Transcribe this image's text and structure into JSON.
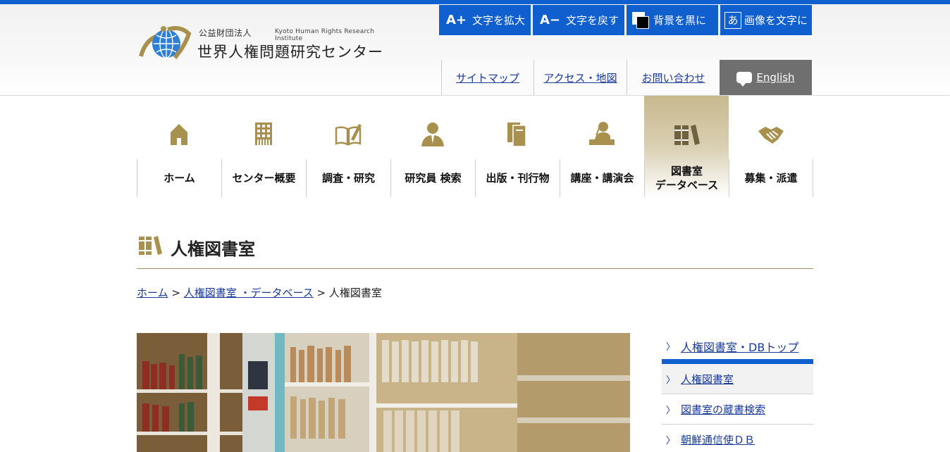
{
  "logo": {
    "org_type": "公益財団法人",
    "name_en": "Kyoto Human Rights Research Institute",
    "name_ja": "世界人権問題研究センター"
  },
  "accessibility": {
    "enlarge_icon": "A+",
    "enlarge": "文字を拡大",
    "reset_icon": "A−",
    "reset": "文字を戻す",
    "bg_black": "背景を黒に",
    "img_text_icon": "あ",
    "img_text": "画像を文字に"
  },
  "utility": {
    "sitemap": "サイトマップ",
    "access": "アクセス・地図",
    "contact": "お問い合わせ",
    "english": "English"
  },
  "nav": [
    {
      "label": "ホーム",
      "icon": "home-icon"
    },
    {
      "label": "センター概要",
      "icon": "building-icon"
    },
    {
      "label": "調査・研究",
      "icon": "book-pen-icon"
    },
    {
      "label": "研究員 検索",
      "icon": "person-icon"
    },
    {
      "label": "出版・刊行物",
      "icon": "publication-icon"
    },
    {
      "label": "講座・講演会",
      "icon": "lecture-icon"
    },
    {
      "label_line1": "図書室",
      "label_line2": "データベース",
      "icon": "books-icon"
    },
    {
      "label": "募集・派遣",
      "icon": "handshake-icon"
    }
  ],
  "page": {
    "title": "人権図書室"
  },
  "breadcrumb": {
    "home": "ホーム",
    "sep": ">",
    "parent": "人権図書室 ・データベース",
    "current": "人権図書室"
  },
  "side_menu": {
    "top": "人権図書室・DBトップ",
    "items": [
      "人権図書室",
      "図書室の蔵書検索",
      "朝鮮通信使ＤＢ"
    ]
  },
  "colors": {
    "accent_blue": "#0f5fcf",
    "gold": "#a0905a",
    "english_bg": "#6f6f6f"
  }
}
